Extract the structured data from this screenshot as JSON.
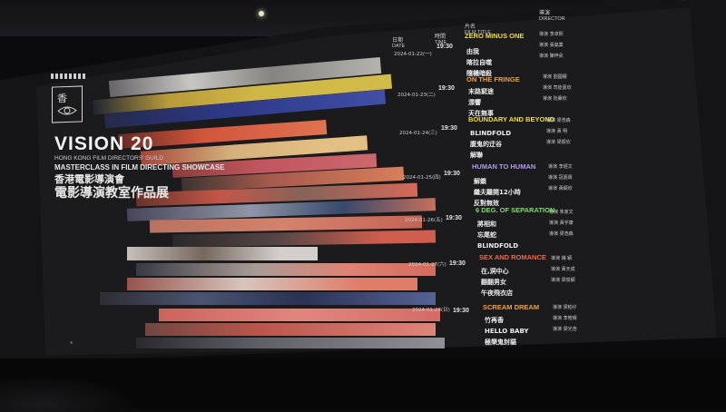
{
  "showcase": {
    "title": "VISION 20",
    "guild_en": "HONG KONG FILM DIRECTORS' GUILD",
    "subtitle_en": "MASTERCLASS IN FILM DIRECTING SHOWCASE",
    "guild_zh": "香港電影導演會",
    "subtitle_zh": "電影導演教室作品展"
  },
  "schedule": {
    "headers": {
      "date_zh": "日期",
      "date_en": "DATE",
      "time_zh": "時間",
      "time_en": "TIME",
      "film_zh": "片名",
      "film_en": "FILM TITLE",
      "director_zh": "導演",
      "director_en": "DIRECTOR"
    },
    "sessions": [
      {
        "date": "2024-01-22(一)",
        "time": "19:30",
        "program": "ZERO MINUS ONE",
        "program_color": "#f1df3c",
        "films": [
          "由我",
          "喀拉自噬",
          "隨機暗殺"
        ],
        "directors": [
          "導演 李卓熙",
          "導演 張燊業",
          "導演 陳梓武"
        ]
      },
      {
        "date": "2024-01-23(二)",
        "time": "19:30",
        "program": "ON THE FRINGE",
        "program_color": "#f0a23a",
        "films": [
          "末路窮途",
          "漂響",
          "天在無事"
        ],
        "directors": [
          "導演 劉國權",
          "導演 司徒嘉欣",
          "導演 阮賽欣"
        ]
      },
      {
        "date": "2024-01-24(三)",
        "time": "19:30",
        "program": "BOUNDARY AND BEYOND",
        "program_color": "#f1df3c",
        "films": [
          "BLINDFOLD",
          "腹鬼的迂谷",
          "解聯"
        ],
        "directors": [
          "導演 梁浩森",
          "導演 黃 明",
          "導演 梁振欣"
        ]
      },
      {
        "date": "2024-01-25(四)",
        "time": "19:30",
        "program": "HUMAN TO HUMAN",
        "program_color": "#b49cf0",
        "films": [
          "解鎖",
          "繼夫離開12小時",
          "反對無效"
        ],
        "directors": [
          "導演 李經文",
          "導演 冠嘉霖",
          "導演 黃穎欣"
        ]
      },
      {
        "date": "2024-01-26(五)",
        "time": "19:30",
        "program": "6 DEG. OF SEPARATION",
        "program_color": "#7fdc6a",
        "films": [
          "將相和",
          "忘尾蛇",
          "BLINDFOLD"
        ],
        "directors": [
          "導演 朱家文",
          "導演 黃宇康",
          "導演 梁浩森"
        ]
      },
      {
        "date": "2024-01-27(六)",
        "time": "19:30",
        "program": "SEX AND ROMANCE",
        "program_color": "#ef6a4a",
        "films": [
          "在,洞中心",
          "翻翻男女",
          "午夜飛衣店"
        ],
        "directors": [
          "導演 楊 穎",
          "導演 黃天成",
          "導演 梁俊穎"
        ]
      },
      {
        "date": "2024-01-28(日)",
        "time": "19:30",
        "program": "SCREAM DREAM",
        "program_color": "#f0a23a",
        "films": [
          "竹再香",
          "HELLO BABY",
          "極樂鬼封貓"
        ],
        "directors": [
          "導演 梁柏仔",
          "導演 李皓晴",
          "導演 梁光浩"
        ]
      }
    ]
  }
}
